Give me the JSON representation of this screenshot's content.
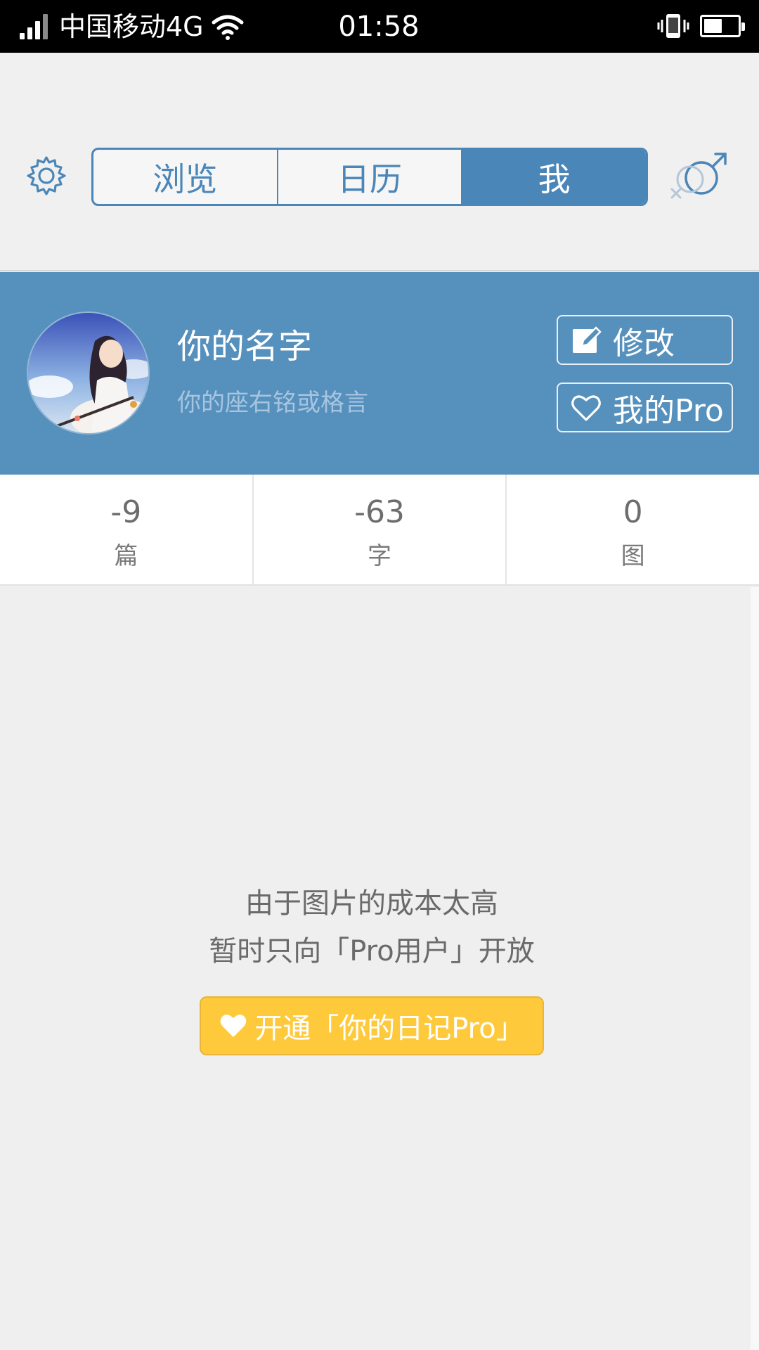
{
  "status_bar": {
    "carrier": "中国移动4G",
    "time": "01:58",
    "battery_level": 0.55
  },
  "tabs": [
    {
      "label": "浏览",
      "active": false
    },
    {
      "label": "日历",
      "active": false
    },
    {
      "label": "我",
      "active": true
    }
  ],
  "profile": {
    "name": "你的名字",
    "motto": "你的座右铭或格言",
    "edit_label": "修改",
    "pro_label": "我的Pro"
  },
  "stats": [
    {
      "value": "-9",
      "label": "篇"
    },
    {
      "value": "-63",
      "label": "字"
    },
    {
      "value": "0",
      "label": "图"
    }
  ],
  "content": {
    "notice_line1": "由于图片的成本太高",
    "notice_line2": "暂时只向「Pro用户」开放",
    "upgrade_label": "开通「你的日记Pro」"
  },
  "colors": {
    "accent": "#4a86b8",
    "banner": "#5690bd",
    "pro_button": "#ffc93c"
  },
  "icons": [
    "signal-icon",
    "wifi-icon",
    "vibrate-icon",
    "battery-icon",
    "gear-icon",
    "gender-icon",
    "edit-icon",
    "heart-icon"
  ]
}
